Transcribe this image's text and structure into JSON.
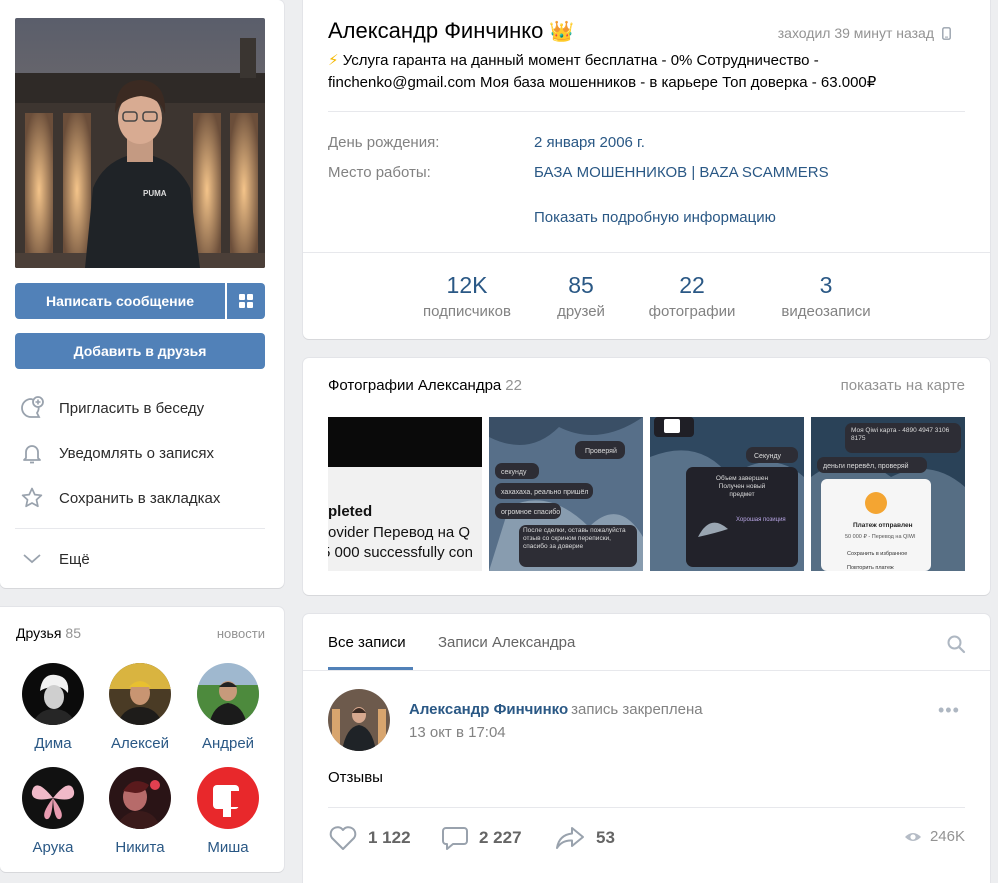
{
  "profile": {
    "name": "Александр Финчинко",
    "crown": "👑",
    "online": "заходил 39 минут назад",
    "status_bolt": "⚡",
    "status_text": "Услуга гаранта на данный момент бесплатна - 0% Сотрудничество - finchenko@gmail.com Моя база мошенников - в карьере Топ доверка - 63.000₽",
    "info": [
      {
        "label": "День рождения:",
        "value": "2 января 2006 г."
      },
      {
        "label": "Место работы:",
        "value": "БАЗА МОШЕННИКОВ | BAZA SCAMMERS"
      }
    ],
    "show_more": "Показать подробную информацию",
    "counters": [
      {
        "num": "12K",
        "cap": "подписчиков"
      },
      {
        "num": "85",
        "cap": "друзей"
      },
      {
        "num": "22",
        "cap": "фотографии"
      },
      {
        "num": "3",
        "cap": "видеозаписи"
      }
    ]
  },
  "actions": {
    "message": "Написать сообщение",
    "add_friend": "Добавить в друзья",
    "menu": [
      {
        "label": "Пригласить в беседу",
        "icon": "chat-plus-icon"
      },
      {
        "label": "Уведомлять о записях",
        "icon": "bell-icon"
      },
      {
        "label": "Сохранить в закладках",
        "icon": "star-icon"
      },
      {
        "label": "Ещё",
        "icon": "chevron-down-icon"
      }
    ]
  },
  "friends": {
    "title": "Друзья",
    "count": "85",
    "news": "новости",
    "list": [
      {
        "name": "Дима"
      },
      {
        "name": "Алексей"
      },
      {
        "name": "Андрей"
      },
      {
        "name": "Арука"
      },
      {
        "name": "Никита"
      },
      {
        "name": "Миша"
      }
    ]
  },
  "photos": {
    "title": "Фотографии Александра",
    "count": "22",
    "map_link": "показать на карте",
    "thumb1_lines": [
      "pleted",
      "ovider Перевод на Q",
      "5 000 successfully con"
    ],
    "thumb2_lines": [
      "Проверяй",
      "секунду",
      "хахахаха, реально пришёл",
      "огромное спасибо",
      "После сделки, оставь пожалуйста отзыв со скрином переписки, спасибо за доверие"
    ],
    "thumb3_lines": [
      "Секунду",
      "Объем завершен Получен новый предмет",
      "Хорошая позиция"
    ],
    "thumb4_lines": [
      "Моя Qiwi карта - 4890 4947 3106 8175",
      "деньги перевёл, проверяй",
      "Платеж отправлен",
      "50 000 ₽ - Перевод на QIWI",
      "Сохранить в избранное",
      "Повторить платеж"
    ]
  },
  "wall": {
    "tab_all": "Все записи",
    "tab_alex": "Записи Александра",
    "post": {
      "author": "Александр Финчинко",
      "pinned": "запись закреплена",
      "date": "13 окт в 17:04",
      "text": "Отзывы",
      "likes": "1 122",
      "comments": "2 227",
      "shares": "53",
      "views": "246K"
    }
  },
  "colors": {
    "accent": "#5181b8",
    "link": "#2a5885",
    "muted": "#828282",
    "background": "#edeef0"
  }
}
